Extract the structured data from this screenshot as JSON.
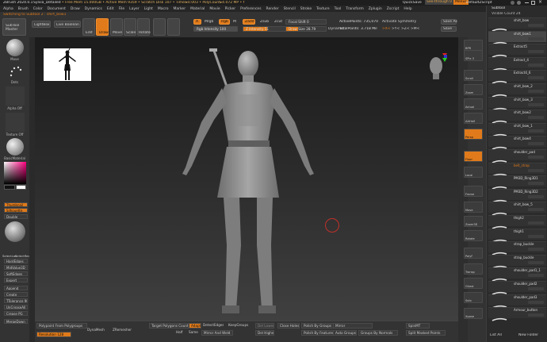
{
  "titlebar": {
    "app": "ZBrush 2024.0.1",
    "file": "Sylvia_Detailed",
    "stats": "• Free Mem 15.000GB • Active Mem 9359 • Scratch Disk 107 • Timer▸0.003 • PolyCount▸4.072 MP • MeshCount▸72",
    "quicksave": "QuickSave",
    "seethrough": "See-through 0",
    "menus_btn": "Menus",
    "script": "DefaultZScript"
  },
  "menubar": [
    "Alpha",
    "Brush",
    "Color",
    "Document",
    "Draw",
    "Dynamics",
    "Edit",
    "File",
    "Layer",
    "Light",
    "Macro",
    "Marker",
    "Material",
    "Movie",
    "Picker",
    "Preferences",
    "Render",
    "Stencil",
    "Stroke",
    "Texture",
    "Tool",
    "Transform",
    "Zplugin",
    "Zscript",
    "Help"
  ],
  "toolbar": {
    "switch_label": "Switching to Subtool 2 : shirt_bow1",
    "lightbox": "LightBox",
    "live_boolean": "Live Boolean",
    "subtool_master": "SubTool Master",
    "edit": "Edit",
    "draw": "Draw",
    "move": "Move",
    "scale": "Scale",
    "rotate": "Rotate",
    "a_btn": "A",
    "mrgb": "Mrgb",
    "rgb": "Rgb",
    "m_btn": "M",
    "zadd": "Zadd",
    "zsub": "Zsub",
    "zcut": "Zcut",
    "rgb_intensity": "Rgb Intensity 100",
    "z_intensity": "Z Intensity 51",
    "focal_shift": "Focal Shift 0",
    "draw_size": "Draw Size 28.79",
    "dynamic": "Dynamic",
    "active_points": "ActivePoints: 735,070",
    "total_points": "TotalPoints: 3.718 Mil",
    "activate_symmetry": "Activate Symmetry",
    "symm_x": ">X<",
    "symm_y": ">Y<",
    "symm_z": ">Z<",
    "symm_m": ">M<",
    "save_as": "Save As",
    "save": "Save"
  },
  "leftshelf": {
    "brush": "Move",
    "stroke": "Dots",
    "alpha": "Alpha Off",
    "texture": "Texture Off",
    "material": "BasicMaterial",
    "gradient": "Gradient",
    "switch_color": "SwitchColor",
    "alternate": "Alternate",
    "thumbnail": "Thumbnail",
    "silhouette": "Silhouette",
    "double": "Double",
    "select_lasso": "SelectLas",
    "select_rect": "SelectRect",
    "buttons": [
      "HardEdges",
      "MidValue3D",
      "SoftEdges",
      "Expert",
      "Append",
      "Create",
      "TTolerance 90",
      "UnCreaseAll",
      "Crease PG",
      "MergeDown"
    ]
  },
  "rightshelf": [
    "BPR",
    "SPix 3",
    "Scroll",
    "Zoom",
    "Actual",
    "AAHalf",
    "Persp",
    "Floor",
    "Local",
    "Frame",
    "Move",
    "Zoom3D",
    "Rotate",
    "PolyF",
    "Transp",
    "Ghost",
    "Solo",
    "Xpose"
  ],
  "subtool": {
    "title": "Subtool",
    "visible_count": "Visible Count 24",
    "items": [
      "shirt_bow",
      "shirt_bow1",
      "Extract5",
      "Extract_4",
      "Extract4_6",
      "shirt_bow_2",
      "shirt_bow_3",
      "shirt_bow2",
      "shirt_bow_1",
      "shirt_bow4",
      "shoulder_pad",
      "belt_strap",
      "PM3D_Ring3D1",
      "PM3D_Ring3D2",
      "shirt_bow_5",
      "thigh2",
      "thigh1",
      "strap_buckle",
      "strap_buckle",
      "shoulder_pad1_1",
      "shoulder_pad2",
      "shoulder_pad3",
      "Armour_button"
    ],
    "list_all": "List All",
    "new_folder": "New Folder"
  },
  "bottombar": {
    "polypaint_from_poly": "Polypaint From Polygroups",
    "dynamesh": "DynaMesh",
    "zremesher": "ZRemesher",
    "resolution": "Resolution 128",
    "target_polygons": "Target Polygons Count 5",
    "adapt": "Adapt",
    "half": "Half",
    "same": "Same",
    "mirror_and_weld": "Mirror And Weld",
    "detect_edges": "DetectEdges",
    "keep_groups": "KeepGroups",
    "del_lower": "Del Lower",
    "del_higher": "Del Higher",
    "close_holes": "Close Holes",
    "polish_by_groups": "Polish By Groups",
    "polish_by_features": "Polish By Features",
    "mirror": "Mirror",
    "auto_groups": "Auto Groups",
    "groups_by_normals": "Groups By Normals",
    "split_masked_points": "Split Masked Points",
    "spin_mt": "SpinMT",
    "ungroup": "GroupSplit"
  },
  "colors": {
    "accent": "#e07a1a",
    "panel": "#333333",
    "canvas_top": "#1b1b1b",
    "canvas_bottom": "#404040"
  }
}
